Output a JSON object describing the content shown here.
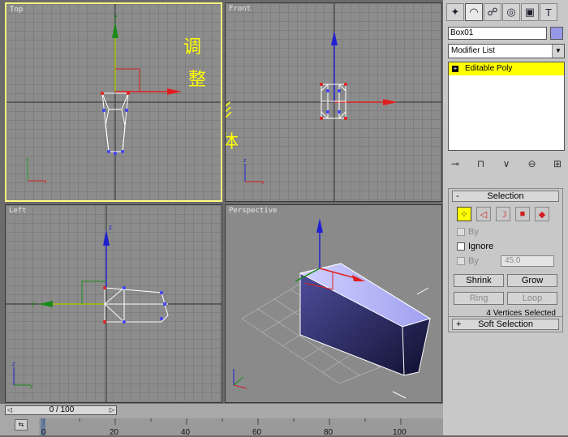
{
  "viewports": {
    "top": "Top",
    "front": "Front",
    "left": "Left",
    "perspective": "Perspective"
  },
  "overlay_text": [
    "调",
    "整",
    "形",
    "体"
  ],
  "command_panel": {
    "tabs": [
      {
        "icon": "create-icon",
        "glyph": "✦"
      },
      {
        "icon": "modify-icon",
        "glyph": "◠"
      },
      {
        "icon": "hierarchy-icon",
        "glyph": "☍"
      },
      {
        "icon": "motion-icon",
        "glyph": "◎"
      },
      {
        "icon": "display-icon",
        "glyph": "▣"
      },
      {
        "icon": "utilities-icon",
        "glyph": "T"
      }
    ],
    "object_name": "Box01",
    "color_swatch": "#9797e8",
    "modifier_list": "Modifier List",
    "stack_items": [
      "Editable Poly"
    ]
  },
  "selection": {
    "header": "Selection",
    "header_sign": "-",
    "by_vertex_label": "By",
    "ignore_label": "Ignore",
    "by_angle_label": "By",
    "angle_value": "45.0",
    "shrink": "Shrink",
    "grow": "Grow",
    "ring": "Ring",
    "loop": "Loop",
    "status": "4 Vertices Selected"
  },
  "soft_selection": {
    "header": "Soft Selection",
    "header_sign": "+"
  },
  "timeline": {
    "frame": "0 / 100",
    "ticks": [
      "0",
      "20",
      "40",
      "60",
      "80",
      "100"
    ]
  }
}
